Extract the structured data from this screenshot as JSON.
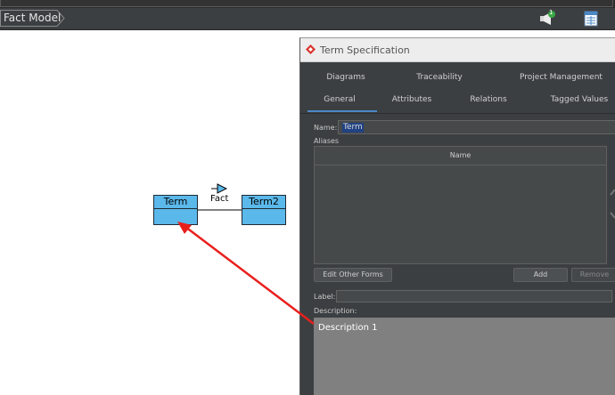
{
  "breadcrumb": {
    "label": "Fact Model"
  },
  "toolbar": {
    "notification_badge": "1",
    "icons": [
      "megaphone-icon",
      "document-grid-icon"
    ]
  },
  "diagram": {
    "class1": {
      "name": "Term"
    },
    "class2": {
      "name": "Term2"
    },
    "association": {
      "label": "Fact"
    }
  },
  "dialog": {
    "title": "Term Specification",
    "tabs_row1": [
      "Diagrams",
      "Traceability",
      "Project Management"
    ],
    "tabs_row2": [
      "General",
      "Attributes",
      "Relations",
      "Tagged Values"
    ],
    "active_tab": "General",
    "name_label": "Name:",
    "name_value": "Term",
    "aliases_label": "Aliases",
    "aliases_table": {
      "header": "Name",
      "rows": []
    },
    "edit_other_forms_label": "Edit Other Forms",
    "add_label": "Add",
    "remove_label": "Remove",
    "label_label": "Label:",
    "label_value": "",
    "description_label": "Description:",
    "description_value": "Description 1"
  },
  "colors": {
    "class_fill": "#5bb8ea",
    "dialog_bg": "#3c3f41",
    "active_tab_underline": "#4a88c7",
    "annotation_arrow": "#e8201c",
    "selection": "#214283"
  }
}
